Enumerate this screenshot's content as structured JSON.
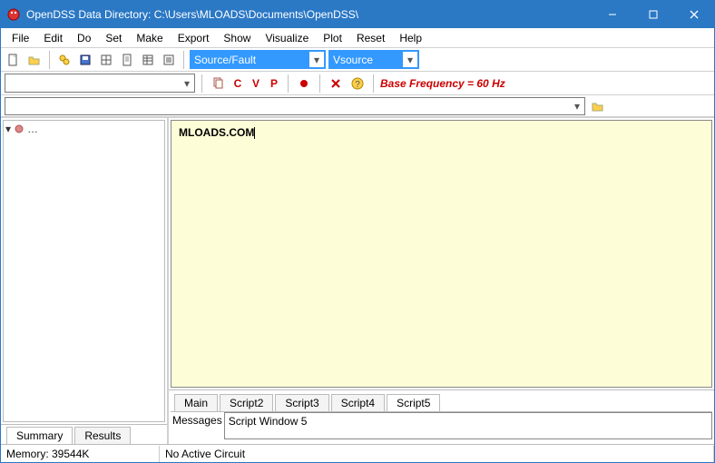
{
  "titlebar": {
    "title": "OpenDSS Data Directory: C:\\Users\\MLOADS\\Documents\\OpenDSS\\"
  },
  "menubar": [
    "File",
    "Edit",
    "Do",
    "Set",
    "Make",
    "Export",
    "Show",
    "Visualize",
    "Plot",
    "Reset",
    "Help"
  ],
  "toolbar1": {
    "combo1": "Source/Fault",
    "combo2": "Vsource"
  },
  "toolbar2": {
    "cvp": {
      "c": "C",
      "v": "V",
      "p": "P"
    },
    "base_freq": "Base Frequency = 60 Hz"
  },
  "left": {
    "tree_row": "…",
    "tabs": {
      "summary": "Summary",
      "results": "Results"
    }
  },
  "right": {
    "editor_text": "MLOADS.COM",
    "tabs": [
      "Main",
      "Script2",
      "Script3",
      "Script4",
      "Script5"
    ],
    "active_tab_index": 4,
    "messages_label": "Messages",
    "messages_body": "Script Window 5"
  },
  "status": {
    "memory": "Memory: 39544K",
    "circuit": "No Active Circuit"
  }
}
